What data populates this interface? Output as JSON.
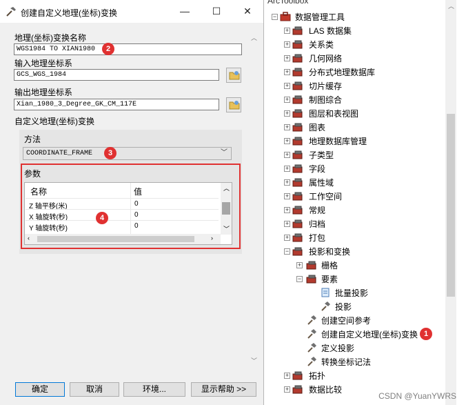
{
  "dialog": {
    "title": "创建自定义地理(坐标)变换",
    "window_controls": {
      "minimize": "—",
      "maximize": "☐",
      "close": "✕"
    },
    "transform_name_label": "地理(坐标)变换名称",
    "transform_name_value": "WGS1984 TO XIAN1980",
    "input_gcs_label": "输入地理坐标系",
    "input_gcs_value": "GCS_WGS_1984",
    "output_gcs_label": "输出地理坐标系",
    "output_gcs_value": "Xian_1980_3_Degree_GK_CM_117E",
    "custom_transform_label": "自定义地理(坐标)变换",
    "method_label": "方法",
    "method_value": "COORDINATE_FRAME",
    "params_label": "参数",
    "params_table": {
      "headers": [
        "名称",
        "值"
      ],
      "rows": [
        {
          "name": "Z 轴平移(米)",
          "value": "0"
        },
        {
          "name": "X 轴旋转(秒)",
          "value": "0"
        },
        {
          "name": "Y 轴旋转(秒)",
          "value": "0"
        }
      ]
    },
    "buttons": {
      "ok": "确定",
      "cancel": "取消",
      "environments": "环境...",
      "show_help": "显示帮助 >>"
    }
  },
  "annotations": [
    "1",
    "2",
    "3",
    "4"
  ],
  "toolbox": {
    "title": "ArcToolbox",
    "root": "数据管理工具",
    "items": [
      "LAS 数据集",
      "关系类",
      "几何网络",
      "分布式地理数据库",
      "切片缓存",
      "制图综合",
      "图层和表视图",
      "图表",
      "地理数据库管理",
      "子类型",
      "字段",
      "属性域",
      "工作空间",
      "常规",
      "归档",
      "打包",
      "投影和变换"
    ],
    "projection_children": [
      "栅格",
      "要素"
    ],
    "feature_children": [
      "批量投影",
      "投影"
    ],
    "projection_tools": [
      "创建空间参考",
      "创建自定义地理(坐标)变换",
      "定义投影",
      "转换坐标记法"
    ],
    "after_items": [
      "拓扑",
      "数据比较"
    ]
  },
  "watermark": "CSDN @YuanYWRS",
  "colors": {
    "annotation_red": "#e03131",
    "toolbox_red": "#c0392b",
    "default_button_border": "#0078d7"
  }
}
